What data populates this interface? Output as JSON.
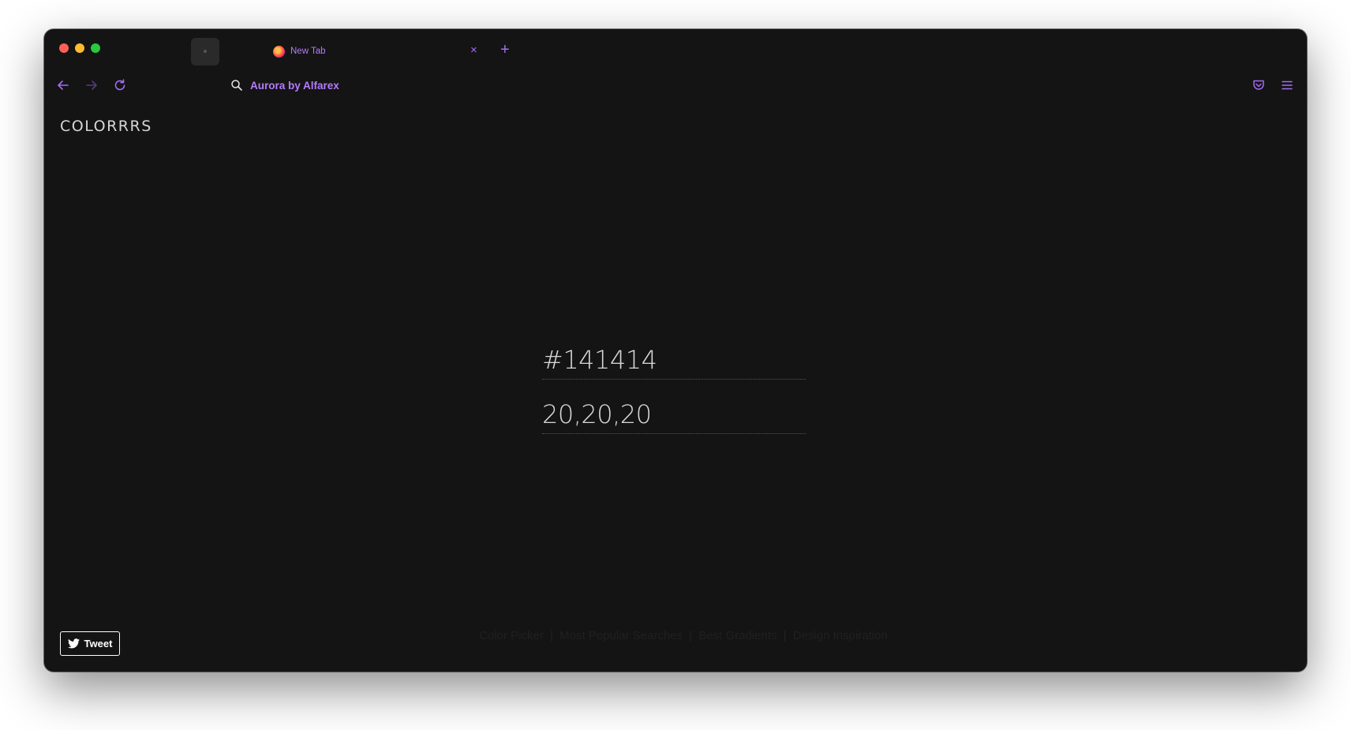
{
  "browser": {
    "tab_title": "New Tab",
    "tab_close": "×",
    "new_tab": "+",
    "url_text": "Aurora by Alfarex",
    "accent_color": "#a56cf7"
  },
  "page": {
    "logo": "COLORRRS",
    "hex_value": "#141414",
    "rgb_value": "20,20,20",
    "background_color": "#141414",
    "tweet_label": "Tweet",
    "footer_links": [
      "Color Picker",
      "Most Popular Searches",
      "Best Gradients",
      "Design Inspiration"
    ],
    "footer_separator": "|"
  },
  "icons": {
    "back": "arrow-left-icon",
    "forward": "arrow-right-icon",
    "reload": "reload-icon",
    "search": "search-icon",
    "pocket": "pocket-icon",
    "menu": "hamburger-menu-icon",
    "twitter": "twitter-bird-icon"
  }
}
